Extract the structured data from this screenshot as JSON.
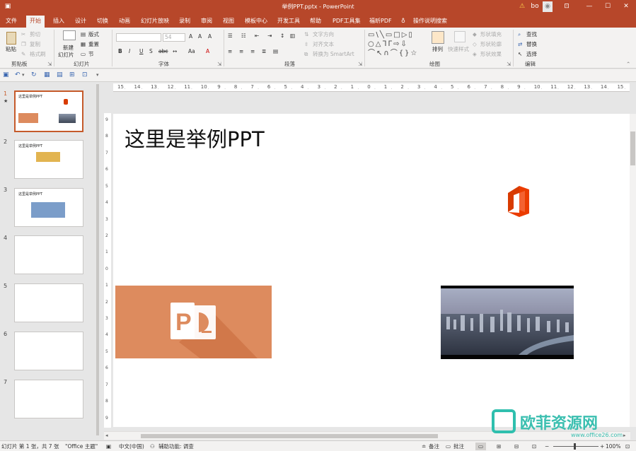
{
  "window": {
    "title": "举例PPT.pptx  -  PowerPoint",
    "warning_icon": "warning-icon",
    "user": "bo"
  },
  "menu": {
    "items": [
      "文件",
      "开始",
      "插入",
      "设计",
      "切换",
      "动画",
      "幻灯片放映",
      "录制",
      "审阅",
      "视图",
      "模板中心",
      "开发工具",
      "帮助",
      "PDF工具集",
      "福昕PDF",
      "操作说明搜索"
    ],
    "active": "开始"
  },
  "ribbon": {
    "clipboard": {
      "paste": "粘贴",
      "cut": "剪切",
      "copy": "复制",
      "format_painter": "格式刷",
      "label": "剪贴板"
    },
    "slides": {
      "new_slide_1": "新建",
      "new_slide_2": "幻灯片",
      "layout": "版式",
      "reset": "重置",
      "section": "节",
      "label": "幻灯片"
    },
    "font": {
      "size": "54",
      "label": "字体",
      "bold": "B",
      "italic": "I",
      "underline": "U",
      "strike": "S",
      "spacing": "abc",
      "aa": "Aa",
      "grow": "A",
      "shrink": "A",
      "clear": "A",
      "color": "A"
    },
    "paragraph": {
      "text_direction": "文字方向",
      "align_text": "对齐文本",
      "smartart": "转换为 SmartArt",
      "label": "段落"
    },
    "drawing": {
      "arrange": "排列",
      "quick_styles": "快速样式",
      "fill": "形状填充",
      "outline": "形状轮廓",
      "effects": "形状效果",
      "label": "绘图"
    },
    "editing": {
      "find": "查找",
      "replace": "替换",
      "select": "选择",
      "label": "编辑"
    }
  },
  "thumbnails": [
    {
      "num": "1",
      "title": "这里是举例PPT",
      "mark": "★"
    },
    {
      "num": "2",
      "title": "这里是举例PPT"
    },
    {
      "num": "3",
      "title": "这里是举例PPT"
    },
    {
      "num": "4"
    },
    {
      "num": "5"
    },
    {
      "num": "6"
    },
    {
      "num": "7"
    }
  ],
  "ruler_h": [
    "15",
    "14",
    "13",
    "12",
    "11",
    "10",
    "9",
    "8",
    "7",
    "6",
    "5",
    "4",
    "3",
    "2",
    "1",
    "0",
    "1",
    "2",
    "3",
    "4",
    "5",
    "6",
    "7",
    "8",
    "9",
    "10",
    "11",
    "12",
    "13",
    "14",
    "15"
  ],
  "ruler_v": [
    "9",
    "8",
    "7",
    "6",
    "5",
    "4",
    "3",
    "2",
    "1",
    "0",
    "1",
    "2",
    "3",
    "4",
    "5",
    "6",
    "7",
    "8",
    "9"
  ],
  "slide": {
    "title": "这里是举例PPT",
    "colors": {
      "ppt_orange": "#d35230",
      "ppt_banner": "#dd8b5e",
      "office_red": "#eb3c00"
    }
  },
  "statusbar": {
    "slide_info": "幻灯片 第 1 张，共 7 张",
    "theme": "\"Office 主题\"",
    "language": "中文(中国)",
    "accessibility": "辅助功能: 调查",
    "notes": "备注",
    "comments": "批注",
    "zoom": "100%"
  },
  "watermark": {
    "text": "欧菲资源网",
    "url": "www.office26.com"
  }
}
